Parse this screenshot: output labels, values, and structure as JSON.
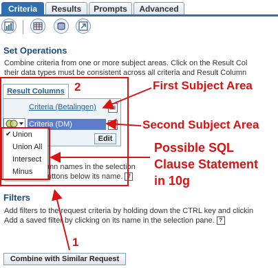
{
  "tabs": [
    {
      "label": "Criteria",
      "active": true
    },
    {
      "label": "Results",
      "active": false
    },
    {
      "label": "Prompts",
      "active": false
    },
    {
      "label": "Advanced",
      "active": false
    }
  ],
  "toolbar": {
    "icons": [
      "report-icon",
      "table-icon",
      "database-icon",
      "export-icon"
    ]
  },
  "set_operations": {
    "title": "Set Operations",
    "line1": "Combine criteria from one or more subject areas. Click on the Result Col",
    "line2": "their data types must be consistent across all criteria and Result Column",
    "line3": "mn names in the selection",
    "line4": "uttons below its name."
  },
  "result_columns": {
    "tab_label": "Result Columns",
    "criteria": [
      "Criteria (Betalingen)",
      "Criteria (DM)"
    ],
    "edit_label": "Edit"
  },
  "set_op_menu": {
    "options": [
      "Union",
      "Union All",
      "Intersect",
      "Minus"
    ],
    "checked": "Union"
  },
  "filters": {
    "title": "Filters",
    "line1": "Add filters to the request criteria by holding down the CTRL key and clickin",
    "line2": "Add a saved filter by clicking on its name in the selection pane."
  },
  "annotations": {
    "num2": "2",
    "first": "First Subject Area",
    "second": "Second Subject Area",
    "possible1": "Possible SQL",
    "possible2": "Clause Statement",
    "possible3": "in 10g",
    "num1": "1"
  },
  "combine_button": "Combine with Similar Request",
  "colors": {
    "accent": "#2f6fb0",
    "annotation": "#dd1111"
  }
}
